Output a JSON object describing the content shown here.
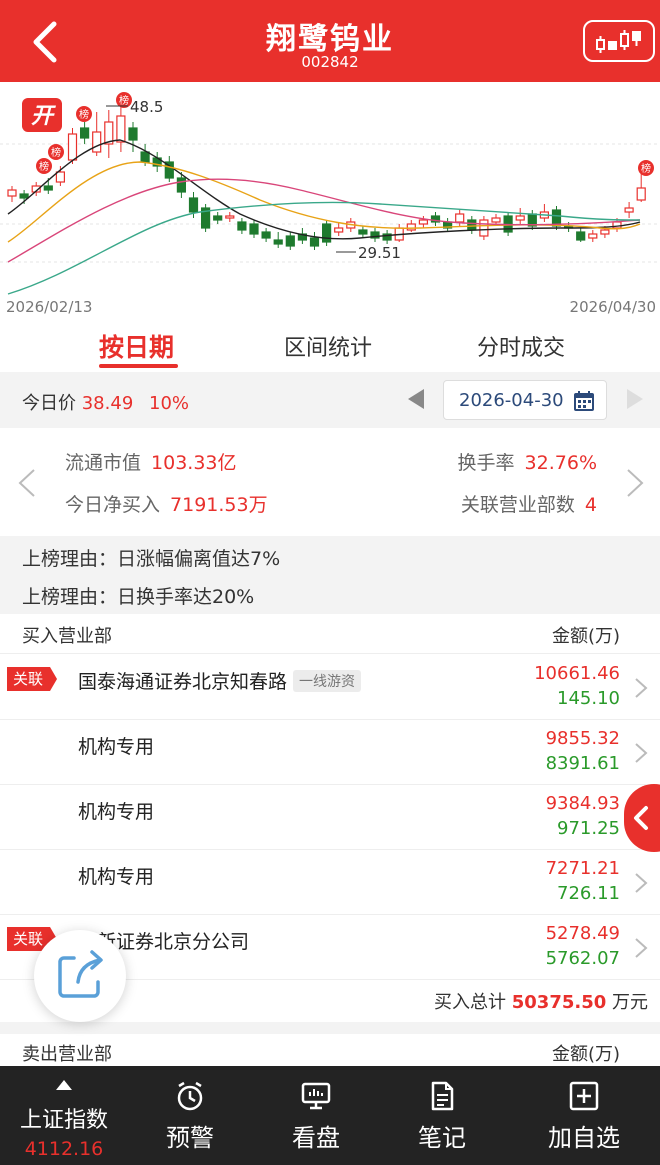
{
  "header": {
    "title": "翔鹭钨业",
    "code": "002842"
  },
  "chart": {
    "open_badge": "开",
    "rank_badge": "榜",
    "high_label": "48.5",
    "low_label": "29.51",
    "date_start": "2026/02/13",
    "date_end": "2026/04/30",
    "colors": {
      "up": "#e8302c",
      "down": "#1e7a2e",
      "ma5": "#222222",
      "ma10": "#e8a317",
      "ma20": "#d9467a",
      "ma60": "#3aa88a"
    }
  },
  "tabs": [
    {
      "label": "按日期",
      "active": true
    },
    {
      "label": "区间统计",
      "active": false
    },
    {
      "label": "分时成交",
      "active": false
    }
  ],
  "datebar": {
    "price_label": "今日价",
    "price": "38.49",
    "change": "10%",
    "date": "2026-04-30"
  },
  "stats": {
    "float_cap_label": "流通市值",
    "float_cap": "103.33亿",
    "turnover_label": "换手率",
    "turnover": "32.76%",
    "net_buy_label": "今日净买入",
    "net_buy": "7191.53万",
    "branch_count_label": "关联营业部数",
    "branch_count": "4"
  },
  "reasons": [
    "上榜理由：日涨幅偏离值达7%",
    "上榜理由：日换手率达20%"
  ],
  "buy_section": {
    "title": "买入营业部",
    "amount_header": "金额(万)",
    "rows": [
      {
        "tag": "关联",
        "name": "国泰海通证券北京知春路",
        "badge": "一线游资",
        "buy": "10661.46",
        "sell": "145.10"
      },
      {
        "tag": "",
        "name": "机构专用",
        "badge": "",
        "buy": "9855.32",
        "sell": "8391.61"
      },
      {
        "tag": "",
        "name": "机构专用",
        "badge": "",
        "buy": "9384.93",
        "sell": "971.25"
      },
      {
        "tag": "",
        "name": "机构专用",
        "badge": "",
        "buy": "7271.21",
        "sell": "726.11"
      },
      {
        "tag": "关联",
        "name": "国新证券北京分公司",
        "badge": "",
        "buy": "5278.49",
        "sell": "5762.07"
      }
    ],
    "total_label": "买入总计",
    "total_value": "50375.50",
    "total_unit": "万元"
  },
  "sell_section": {
    "title": "卖出营业部",
    "amount_header": "金额(万)"
  },
  "bottom_nav": {
    "index_name": "上证指数",
    "index_value": "4112.16",
    "items": [
      {
        "label": "预警",
        "icon": "alarm-clock-icon"
      },
      {
        "label": "看盘",
        "icon": "monitor-chart-icon"
      },
      {
        "label": "笔记",
        "icon": "notes-icon"
      },
      {
        "label": "加自选",
        "icon": "add-square-icon"
      }
    ]
  }
}
